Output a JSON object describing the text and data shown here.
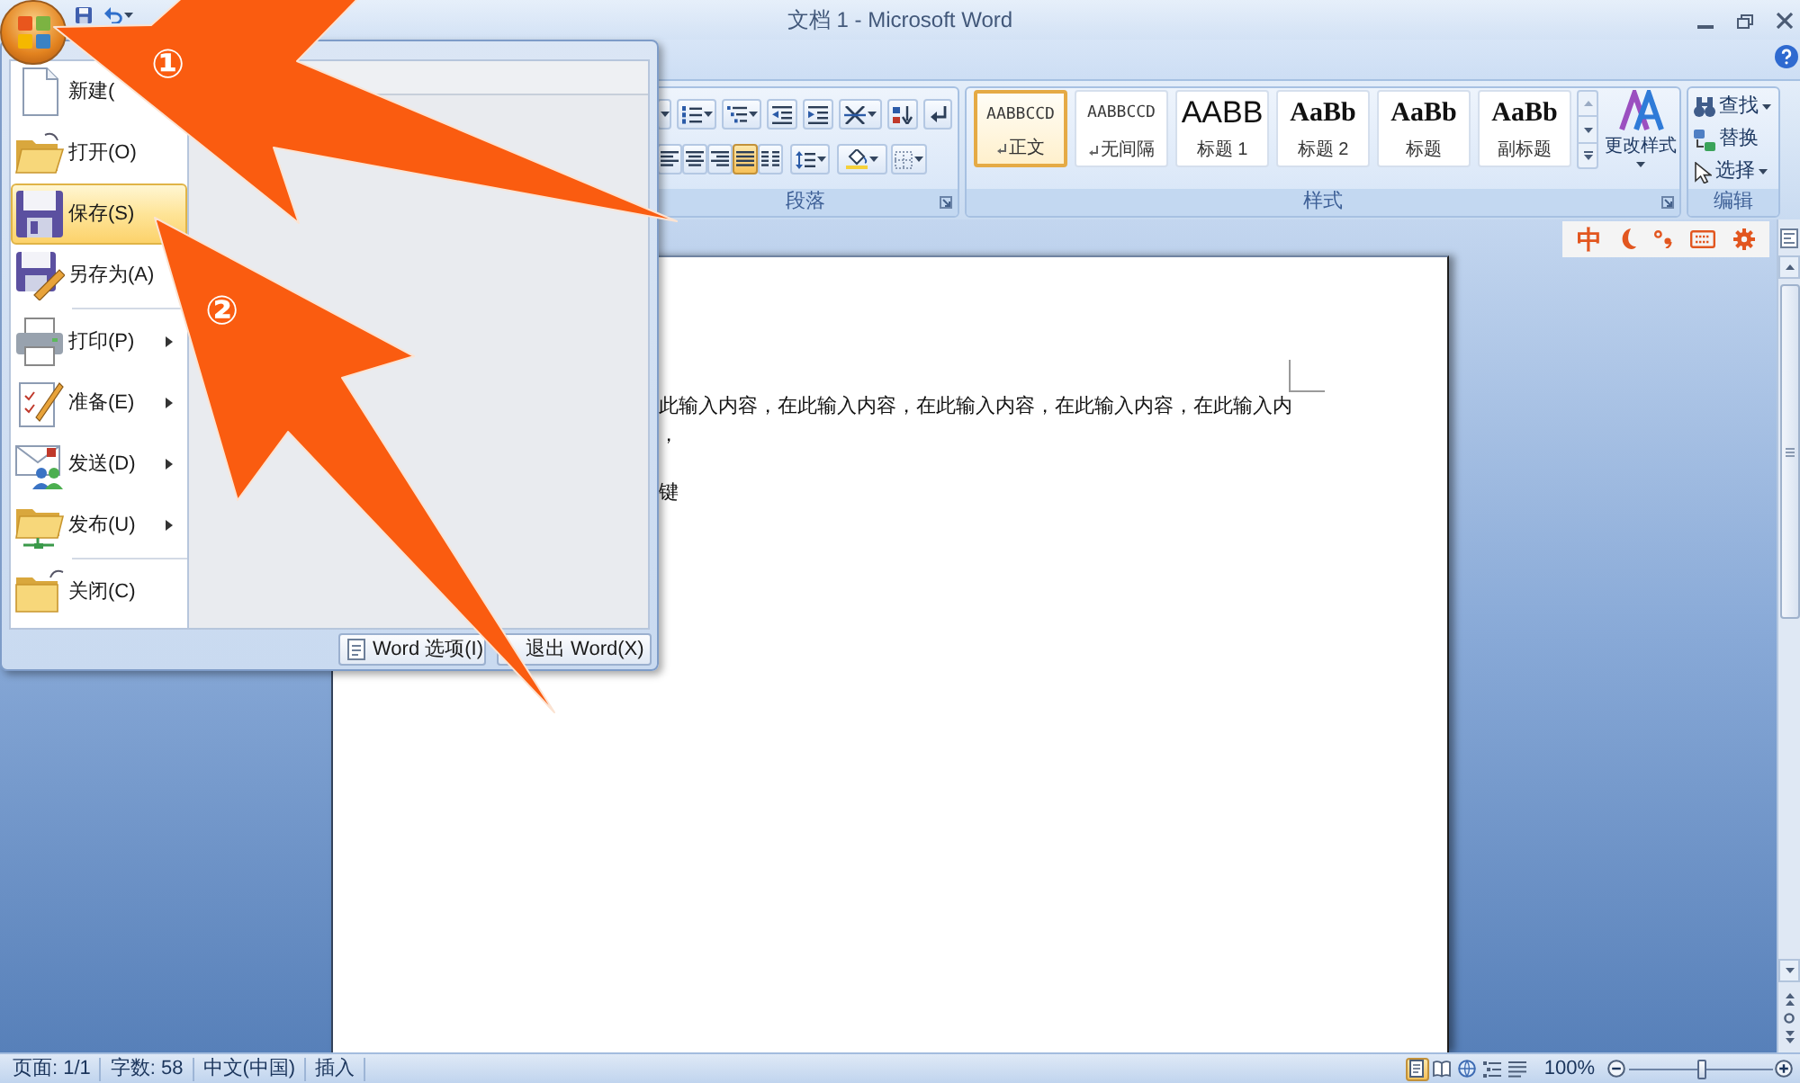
{
  "window": {
    "title": "文档 1 - Microsoft Word"
  },
  "ribbon": {
    "paragraph": {
      "label": "段落",
      "align_buttons": [
        {
          "kind": "left",
          "selected": false
        },
        {
          "kind": "center",
          "selected": false
        },
        {
          "kind": "right",
          "selected": false
        },
        {
          "kind": "justify",
          "selected": true
        },
        {
          "kind": "distributed",
          "selected": false
        }
      ]
    },
    "styles": {
      "label": "样式",
      "items": [
        {
          "preview": "AABBCCD",
          "name": "正文",
          "kind": "small",
          "paragraph_mark": true,
          "selected": true
        },
        {
          "preview": "AABBCCD",
          "name": "无间隔",
          "kind": "small",
          "paragraph_mark": true,
          "selected": false
        },
        {
          "preview": "AABB",
          "name": "标题 1",
          "kind": "tall",
          "paragraph_mark": false,
          "selected": false
        },
        {
          "preview": "AaBb",
          "name": "标题 2",
          "kind": "bold",
          "paragraph_mark": false,
          "selected": false
        },
        {
          "preview": "AaBb",
          "name": "标题",
          "kind": "bold",
          "paragraph_mark": false,
          "selected": false
        },
        {
          "preview": "AaBb",
          "name": "副标题",
          "kind": "bold",
          "paragraph_mark": false,
          "selected": false
        }
      ],
      "change_styles": "更改样式"
    },
    "editing": {
      "label": "编辑",
      "items": [
        {
          "kind": "find",
          "label": "查找",
          "dropdown": true
        },
        {
          "kind": "replace",
          "label": "替换",
          "dropdown": false
        },
        {
          "kind": "select",
          "label": "选择",
          "dropdown": true
        }
      ]
    }
  },
  "ime_bar": {
    "mode": "中"
  },
  "document": {
    "paragraphs": [
      [
        "此输入内容，在此输入内容，在此输入内容，在此输入内容，在此输入内",
        "，"
      ],
      [
        "键"
      ]
    ]
  },
  "office_menu": {
    "items": [
      {
        "kind": "new",
        "label": "新建(",
        "selected": false,
        "submenu": false,
        "divider_before": false
      },
      {
        "kind": "open",
        "label": "打开(O)",
        "selected": false,
        "submenu": false,
        "divider_before": false
      },
      {
        "kind": "save",
        "label": "保存(S)",
        "selected": true,
        "submenu": false,
        "divider_before": false
      },
      {
        "kind": "save_as",
        "label": "另存为(A)",
        "selected": false,
        "submenu": false,
        "divider_before": false
      },
      {
        "kind": "print",
        "label": "打印(P)",
        "selected": false,
        "submenu": true,
        "divider_before": true
      },
      {
        "kind": "prepare",
        "label": "准备(E)",
        "selected": false,
        "submenu": true,
        "divider_before": false
      },
      {
        "kind": "send",
        "label": "发送(D)",
        "selected": false,
        "submenu": true,
        "divider_before": false
      },
      {
        "kind": "publish",
        "label": "发布(U)",
        "selected": false,
        "submenu": true,
        "divider_before": false
      },
      {
        "kind": "close",
        "label": "关闭(C)",
        "selected": false,
        "submenu": false,
        "divider_before": true
      }
    ],
    "buttons": [
      {
        "kind": "options",
        "label": "Word 选项(I)"
      },
      {
        "kind": "exit",
        "label": "退出 Word(X)"
      }
    ]
  },
  "status_bar": {
    "items": [
      "页面: 1/1",
      "字数: 58",
      "中文(中国)",
      "插入"
    ],
    "views": [
      {
        "kind": "print_layout",
        "selected": true
      },
      {
        "kind": "reading",
        "selected": false
      },
      {
        "kind": "web",
        "selected": false
      },
      {
        "kind": "outline",
        "selected": false
      },
      {
        "kind": "draft",
        "selected": false
      }
    ],
    "zoom": {
      "label": "100%",
      "level": 0.5
    }
  },
  "annotations": [
    {
      "label": "①"
    },
    {
      "label": "②"
    }
  ]
}
